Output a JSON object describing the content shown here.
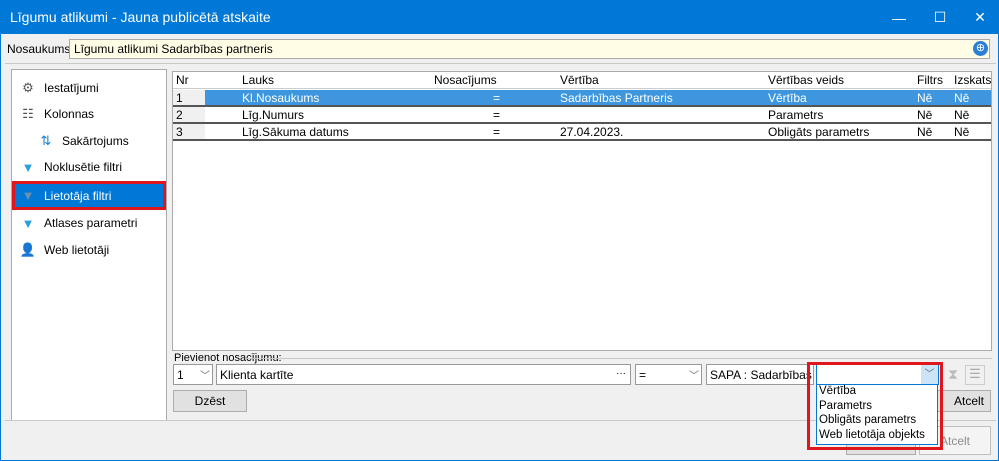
{
  "window": {
    "title": "Līgumu atlikumi - Jauna publicētā atskaite",
    "minimize": "—",
    "maximize": "☐",
    "close": "✕"
  },
  "name": {
    "label": "Nosaukums:",
    "value": "Līgumu atlikumi Sadarbības partneris"
  },
  "nav": [
    {
      "label": "Iestatījumi",
      "icon": "settings-icon"
    },
    {
      "label": "Kolonnas",
      "icon": "columns-icon"
    },
    {
      "label": "Sakārtojums",
      "icon": "sort-icon"
    },
    {
      "label": "Noklusētie filtri",
      "icon": "filter-default-icon"
    },
    {
      "label": "Lietotāja filtri",
      "icon": "user-filter-icon"
    },
    {
      "label": "Atlases parametri",
      "icon": "filter-icon"
    },
    {
      "label": "Web lietotāji",
      "icon": "user-icon"
    }
  ],
  "grid": {
    "headers": [
      "Nr",
      "Lauks",
      "Nosacījums",
      "Vērtība",
      "Vērtības veids",
      "Filtrs",
      "Izskats"
    ],
    "rows": [
      [
        "1",
        "Kl.Nosaukums",
        "=",
        "Sadarbības Partneris",
        "Vērtība",
        "Nē",
        "Nē"
      ],
      [
        "2",
        "Līg.Numurs",
        "=",
        "",
        "Parametrs",
        "Nē",
        "Nē"
      ],
      [
        "3",
        "Līg.Sākuma datums",
        "=",
        "27.04.2023.",
        "Obligāts parametrs",
        "Nē",
        "Nē"
      ]
    ]
  },
  "add": {
    "label": "Pievienot nosacījumu:",
    "nr": "1",
    "field": "Klienta kartīte",
    "ellipsis": "···",
    "operator": "=",
    "value": "SAPA : Sadarbības pa",
    "type": "",
    "delete": "Dzēst",
    "cancel": "Atcelt"
  },
  "dropdown_options": [
    "Vērtība",
    "Parametrs",
    "Obligāts parametrs",
    "Web lietotāja objekts"
  ],
  "footer": {
    "cancel": "Atcelt"
  },
  "colors": {
    "accent": "#0078d7",
    "highlight": "#e0161d",
    "selected_row": "#3d96de"
  }
}
